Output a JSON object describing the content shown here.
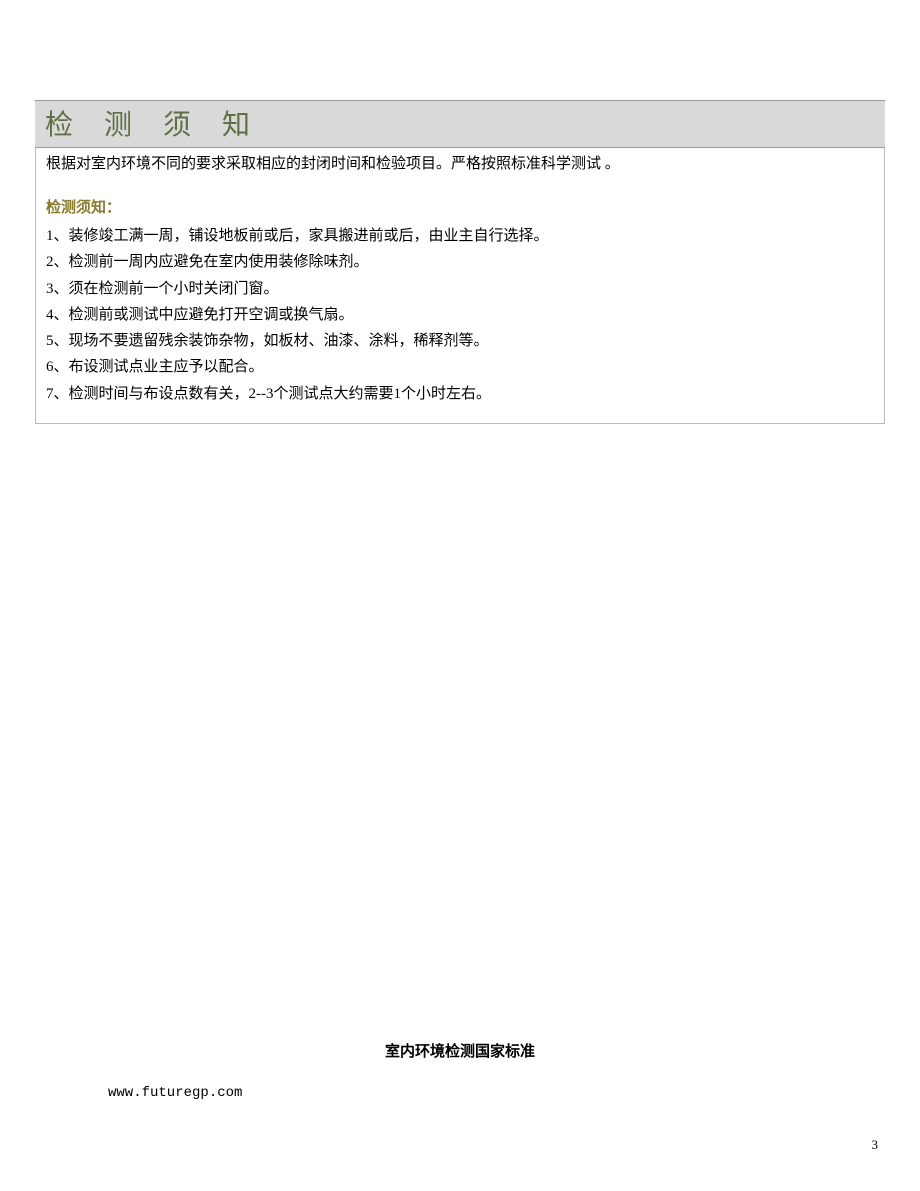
{
  "title": "检 测 须 知",
  "intro": "根据对室内环境不同的要求采取相应的封闭时间和检验项目。严格按照标准科学测试 。",
  "subtitle": "检测须知：",
  "items": [
    "1、装修竣工满一周，铺设地板前或后，家具搬进前或后，由业主自行选择。",
    "2、检测前一周内应避免在室内使用装修除味剂。",
    "3、须在检测前一个小时关闭门窗。",
    "4、检测前或测试中应避免打开空调或换气扇。",
    "5、现场不要遗留残余装饰杂物，如板材、油漆、涂料，稀释剂等。",
    "6、布设测试点业主应予以配合。",
    "7、检测时间与布设点数有关，2--3个测试点大约需要1个小时左右。"
  ],
  "footer": {
    "title": "室内环境检测国家标准",
    "url": "www.futuregp.com"
  },
  "pageNumber": "3"
}
